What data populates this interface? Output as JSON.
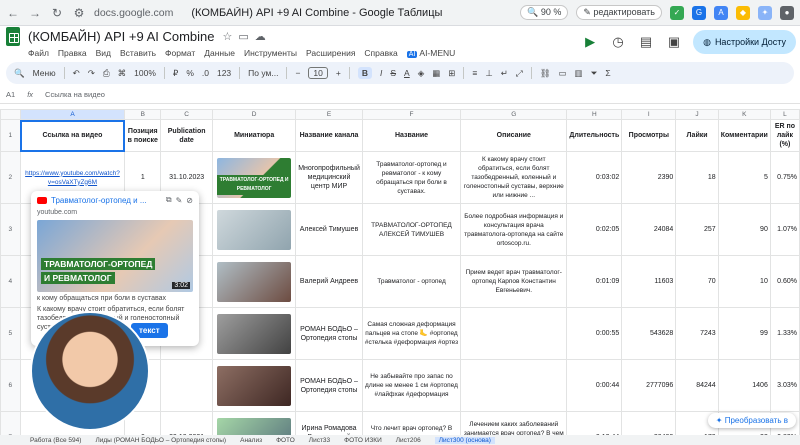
{
  "browser": {
    "url": "docs.google.com",
    "tab_title": "(КОМБАЙН) API +9 AI Combine - Google Таблицы",
    "zoom": "90 %",
    "edit_label": "редактировать"
  },
  "app": {
    "doc_title": "(КОМБАЙН) API  +9 AI Combine",
    "menu": [
      "Файл",
      "Правка",
      "Вид",
      "Вставить",
      "Формат",
      "Данные",
      "Инструменты",
      "Расширения",
      "Справка"
    ],
    "ai_badge": "AI",
    "ai_menu": "AI-MENU",
    "settings_button": "Настройки Досту"
  },
  "toolbar": {
    "menu_label": "Меню",
    "zoom": "100%",
    "currency": "₽",
    "percent": "%",
    "decimals": ".0",
    "number_format": "123",
    "font": "По ум...",
    "font_size": "10",
    "bold": "B"
  },
  "formula_bar": {
    "cell": "A1",
    "content": "Ссылка на видео"
  },
  "columns": [
    "A",
    "B",
    "C",
    "D",
    "E",
    "F",
    "G",
    "H",
    "I",
    "J",
    "K",
    "L"
  ],
  "table": {
    "headers": [
      "Ссылка на видео",
      "Позиция в поиске",
      "Publication date",
      "Миниатюра",
      "Название канала",
      "Название",
      "Описание",
      "Длительность",
      "Просмотры",
      "Лайки",
      "Комментарии",
      "ER по лайк (%)"
    ],
    "rows": [
      {
        "n": "2",
        "link": "https://www.youtube.com/watch?v=osVaXTyZg6M",
        "pos": "1",
        "date": "31.10.2023",
        "thumb": "ТРАВМАТОЛОГ-ОРТОПЕД И РЕВМАТОЛОГ",
        "channel": "Многопрофильный медицинский центр МИР",
        "title": "Травматолог-ортопед и ревматолог - к кому обращаться при боли в суставах.",
        "desc": "К какому врачу стоит обратиться, если болят тазобедренный, коленный и голеностопный суставы, верхние или нижние ...",
        "dur": "0:03:02",
        "views": "2390",
        "likes": "18",
        "comments": "5",
        "er": "0.75%"
      },
      {
        "n": "3",
        "link": "",
        "pos": "",
        "date": "022",
        "thumb": "",
        "channel": "Алексей Тимушев",
        "title": "ТРАВМАТОЛОГ-ОРТОПЕД АЛЕКСЕЙ ТИМУШЕВ",
        "desc": "Более подробная информация и консультация врача травматолога-ортопеда на сайте ortoscop.ru.",
        "dur": "0:02:05",
        "views": "24084",
        "likes": "257",
        "comments": "90",
        "er": "1.07%"
      },
      {
        "n": "4",
        "link": "",
        "pos": "",
        "date": "019",
        "thumb": "",
        "channel": "Валерий Андреев",
        "title": "Травматолог - ортопед",
        "desc": "Прием ведет врач травматолог-ортопед Карпов Константин Евгеньевич.",
        "dur": "0:01:09",
        "views": "11603",
        "likes": "70",
        "comments": "10",
        "er": "0.60%"
      },
      {
        "n": "5",
        "link": "",
        "pos": "",
        "date": "",
        "thumb": "",
        "channel": "РОМАН БОДЬО – Ортопедия стопы",
        "title": "Самая сложная деформация пальцев на стопе 🦶 #ортопед #стелька #деформация #ортез",
        "desc": "",
        "dur": "0:00:55",
        "views": "543628",
        "likes": "7243",
        "comments": "99",
        "er": "1.33%"
      },
      {
        "n": "6",
        "link": "",
        "pos": "",
        "date": "",
        "thumb": "",
        "channel": "РОМАН БОДЬО – Ортопедия стопы",
        "title": "Не забывайте про запас по длине не менее 1 см #ортопед #лайфхак #деформация",
        "desc": "",
        "dur": "0:00:44",
        "views": "2777096",
        "likes": "84244",
        "comments": "1406",
        "er": "3.03%"
      },
      {
        "n": "7",
        "link": "",
        "pos": "6",
        "date": "29.10.2021",
        "thumb": "ЧТО ЛЕЧИТ ОРТОПЕД?",
        "channel": "Ирина Ромадова Врач детский проктолог",
        "title": "Что лечит врач ортопед? В каких случаях надо обращаться к ортопеду?",
        "desc": "Лечением каких заболеваний занимается врач ортопед? В чем разница между ортопедом в России и в Европе. Инстаграм ...",
        "dur": "0:12:44",
        "views": "20400",
        "likes": "170",
        "comments": "23",
        "er": "0.83%"
      }
    ]
  },
  "preview_card": {
    "title": "Травматолог-ортопед и ...",
    "source": "youtube.com",
    "overlay_line1": "ТРАВМАТОЛОГ-ОРТОПЕД",
    "overlay_line2": "И РЕВМАТОЛОГ",
    "duration": "3:02",
    "desc_line1": "к кому обращаться при боли в суставах",
    "desc_line2": "К какому врачу стоит обратиться, если болят тазобедренный, коленный и голеностопный суставы...",
    "button": "текст"
  },
  "explore_button": "Преобразовать в",
  "sheet_tabs": [
    "Работа (Все 594)",
    "Лиды (РОМАН БОДЬО – Ортопедия стопы)",
    "Анализ",
    "ФОТО",
    "Лист33",
    "ФОТО ИЗКИ",
    "Лист206",
    "Лист300 (основа)"
  ],
  "colors": {
    "accent": "#1a73e8",
    "brand_green": "#188038",
    "selection": "#d3e3fd"
  }
}
